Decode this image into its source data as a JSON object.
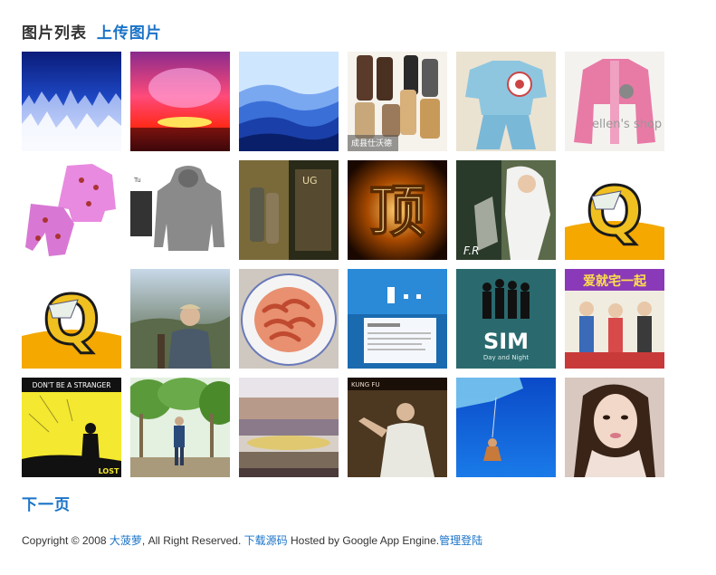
{
  "header": {
    "title": "图片列表",
    "upload_link": "上传图片"
  },
  "images": [
    {
      "name": "snowy-forest"
    },
    {
      "name": "sunset"
    },
    {
      "name": "blue-mountains"
    },
    {
      "name": "boots",
      "caption": "成县仕沃德"
    },
    {
      "name": "blue-pajamas"
    },
    {
      "name": "pink-jacket",
      "caption": "ellen's shop"
    },
    {
      "name": "pink-pajamas"
    },
    {
      "name": "grey-hoodie"
    },
    {
      "name": "boots-photo"
    },
    {
      "name": "ding-character",
      "caption": "顶"
    },
    {
      "name": "girl-photo"
    },
    {
      "name": "q-logo",
      "caption": "Q"
    },
    {
      "name": "q-logo",
      "caption": "Q"
    },
    {
      "name": "man-portrait"
    },
    {
      "name": "shrimp-plate"
    },
    {
      "name": "website-screenshot"
    },
    {
      "name": "sim-poster",
      "caption": "SIM",
      "subcaption": "Day and Night"
    },
    {
      "name": "movie-poster",
      "caption": "爱就宅一起"
    },
    {
      "name": "stranger-poster",
      "caption": "DON'T BE A STRANGER",
      "subcaption": "LOST"
    },
    {
      "name": "trees-photo"
    },
    {
      "name": "landscape-collage"
    },
    {
      "name": "martial-arts-still"
    },
    {
      "name": "bungee-jump"
    },
    {
      "name": "woman-portrait"
    }
  ],
  "pagination": {
    "next_label": "下一页"
  },
  "footer": {
    "copyright_prefix": "Copyright © 2008 ",
    "author_link": "大菠萝",
    "rights": ", All Right Reserved. ",
    "source_link": "下载源码",
    "hosted": " Hosted by Google App Engine.",
    "admin_link": "管理登陆"
  },
  "colors": {
    "link": "#1a73c8",
    "text": "#333333"
  }
}
